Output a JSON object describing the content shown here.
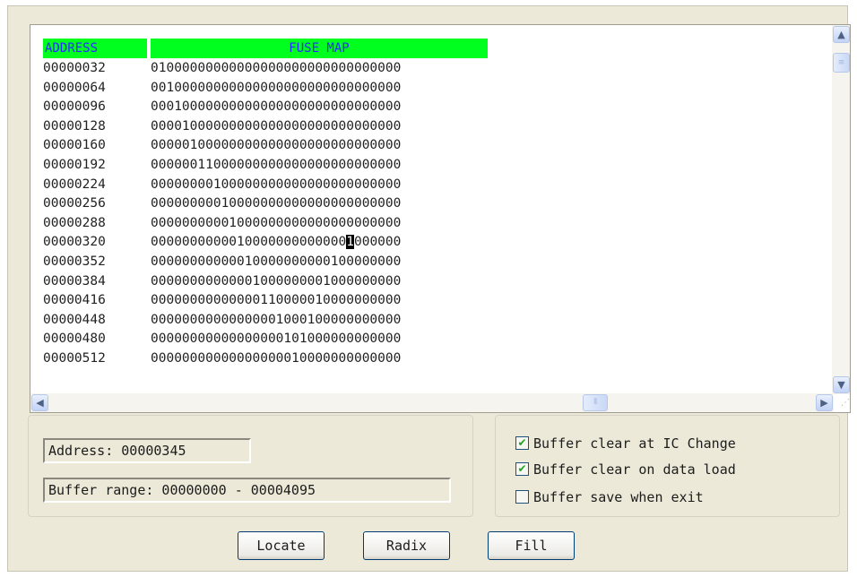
{
  "table": {
    "address_header": "ADDRESS",
    "fusemap_header": "FUSE MAP",
    "rows": [
      {
        "address": "00000032",
        "bits": "01000000000000000000000000000000"
      },
      {
        "address": "00000064",
        "bits": "00100000000000000000000000000000"
      },
      {
        "address": "00000096",
        "bits": "00010000000000000000000000000000"
      },
      {
        "address": "00000128",
        "bits": "00001000000000000000000000000000"
      },
      {
        "address": "00000160",
        "bits": "00000100000000000000000000000000"
      },
      {
        "address": "00000192",
        "bits": "00000011000000000000000000000000"
      },
      {
        "address": "00000224",
        "bits": "00000000100000000000000000000000"
      },
      {
        "address": "00000256",
        "bits": "00000000010000000000000000000000"
      },
      {
        "address": "00000288",
        "bits": "00000000001000000000000000000000"
      },
      {
        "address": "00000320",
        "bits": "00000000000100000000000001000000",
        "cursor_col": 25
      },
      {
        "address": "00000352",
        "bits": "00000000000010000000000100000000"
      },
      {
        "address": "00000384",
        "bits": "00000000000001000000001000000000"
      },
      {
        "address": "00000416",
        "bits": "00000000000000110000010000000000"
      },
      {
        "address": "00000448",
        "bits": "00000000000000001000100000000000"
      },
      {
        "address": "00000480",
        "bits": "00000000000000000101000000000000"
      },
      {
        "address": "00000512",
        "bits": "00000000000000000010000000000000"
      }
    ]
  },
  "scroll": {
    "vertical_position": 0.03,
    "horizontal_position": 0.72
  },
  "info": {
    "address_text": "Address: 00000345",
    "range_text": "Buffer range: 00000000 - 00004095"
  },
  "options": [
    {
      "label": "Buffer clear at IC Change",
      "checked": true
    },
    {
      "label": "Buffer clear on data load",
      "checked": true
    },
    {
      "label": "Buffer save when exit",
      "checked": false
    }
  ],
  "buttons": {
    "locate": "Locate",
    "radix": "Radix",
    "fill": "Fill"
  },
  "icons": {
    "up": "scroll-up-arrow-icon",
    "down": "scroll-down-arrow-icon",
    "left": "scroll-left-arrow-icon",
    "right": "scroll-right-arrow-icon"
  },
  "colors": {
    "header_bg": "#00ff1e",
    "header_text": "#2a2aff",
    "dialog_bg": "#ece9d8",
    "check_mark": "#21a121"
  }
}
